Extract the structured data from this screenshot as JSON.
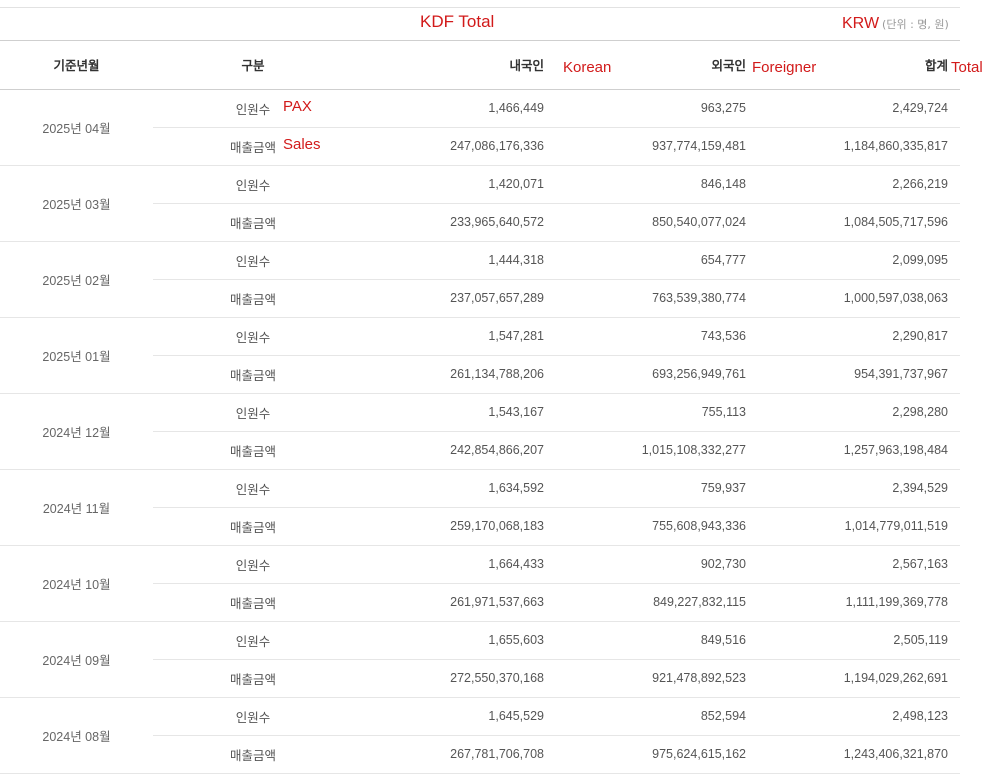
{
  "annotations": {
    "title": "KDF Total",
    "currency": "KRW",
    "korean": "Korean",
    "foreigner": "Foreigner",
    "total": "Total",
    "pax": "PAX",
    "sales": "Sales"
  },
  "unit_label": "(단위 : 명, 원)",
  "headers": {
    "month": "기준년월",
    "category": "구분",
    "korean": "내국인",
    "foreigner": "외국인",
    "total": "합계"
  },
  "rows": [
    {
      "month": "2025년 04월",
      "pax": {
        "label": "인원수",
        "korean": "1,466,449",
        "foreigner": "963,275",
        "total": "2,429,724"
      },
      "sales": {
        "label": "매출금액",
        "korean": "247,086,176,336",
        "foreigner": "937,774,159,481",
        "total": "1,184,860,335,817"
      }
    },
    {
      "month": "2025년 03월",
      "pax": {
        "label": "인원수",
        "korean": "1,420,071",
        "foreigner": "846,148",
        "total": "2,266,219"
      },
      "sales": {
        "label": "매출금액",
        "korean": "233,965,640,572",
        "foreigner": "850,540,077,024",
        "total": "1,084,505,717,596"
      }
    },
    {
      "month": "2025년 02월",
      "pax": {
        "label": "인원수",
        "korean": "1,444,318",
        "foreigner": "654,777",
        "total": "2,099,095"
      },
      "sales": {
        "label": "매출금액",
        "korean": "237,057,657,289",
        "foreigner": "763,539,380,774",
        "total": "1,000,597,038,063"
      }
    },
    {
      "month": "2025년 01월",
      "pax": {
        "label": "인원수",
        "korean": "1,547,281",
        "foreigner": "743,536",
        "total": "2,290,817"
      },
      "sales": {
        "label": "매출금액",
        "korean": "261,134,788,206",
        "foreigner": "693,256,949,761",
        "total": "954,391,737,967"
      }
    },
    {
      "month": "2024년 12월",
      "pax": {
        "label": "인원수",
        "korean": "1,543,167",
        "foreigner": "755,113",
        "total": "2,298,280"
      },
      "sales": {
        "label": "매출금액",
        "korean": "242,854,866,207",
        "foreigner": "1,015,108,332,277",
        "total": "1,257,963,198,484"
      }
    },
    {
      "month": "2024년 11월",
      "pax": {
        "label": "인원수",
        "korean": "1,634,592",
        "foreigner": "759,937",
        "total": "2,394,529"
      },
      "sales": {
        "label": "매출금액",
        "korean": "259,170,068,183",
        "foreigner": "755,608,943,336",
        "total": "1,014,779,011,519"
      }
    },
    {
      "month": "2024년 10월",
      "pax": {
        "label": "인원수",
        "korean": "1,664,433",
        "foreigner": "902,730",
        "total": "2,567,163"
      },
      "sales": {
        "label": "매출금액",
        "korean": "261,971,537,663",
        "foreigner": "849,227,832,115",
        "total": "1,111,199,369,778"
      }
    },
    {
      "month": "2024년 09월",
      "pax": {
        "label": "인원수",
        "korean": "1,655,603",
        "foreigner": "849,516",
        "total": "2,505,119"
      },
      "sales": {
        "label": "매출금액",
        "korean": "272,550,370,168",
        "foreigner": "921,478,892,523",
        "total": "1,194,029,262,691"
      }
    },
    {
      "month": "2024년 08월",
      "pax": {
        "label": "인원수",
        "korean": "1,645,529",
        "foreigner": "852,594",
        "total": "2,498,123"
      },
      "sales": {
        "label": "매출금액",
        "korean": "267,781,706,708",
        "foreigner": "975,624,615,162",
        "total": "1,243,406,321,870"
      }
    }
  ]
}
